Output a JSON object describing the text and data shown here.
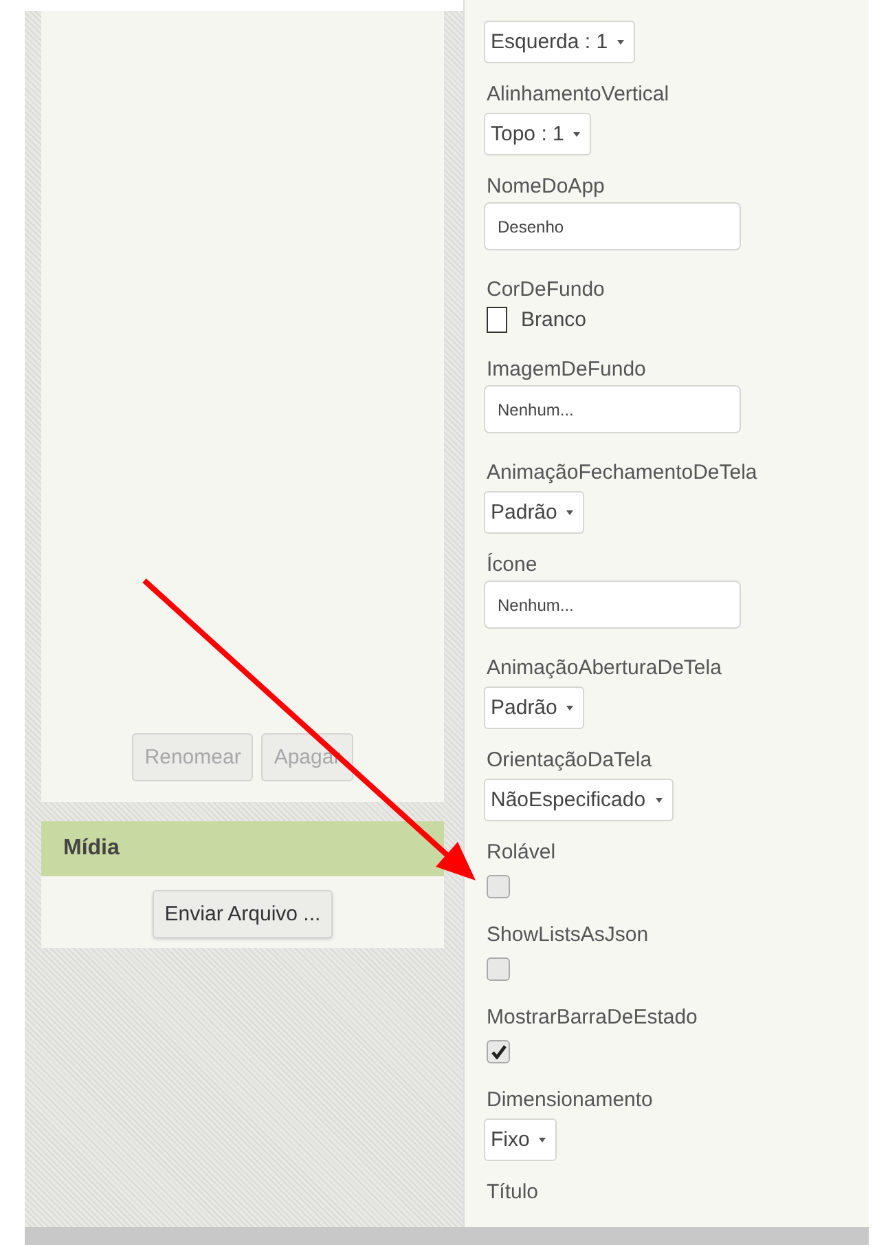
{
  "assets_panel": {
    "buttons": [
      {
        "label": "Renomear",
        "disabled": true
      },
      {
        "label": "Apagar",
        "disabled": true
      }
    ]
  },
  "media_panel": {
    "title": "Mídia",
    "button": "Enviar Arquivo ..."
  },
  "properties": [
    {
      "kind": "dropdown",
      "value": "Esquerda : 1"
    },
    {
      "kind": "dropdown",
      "label": "AlinhamentoVertical",
      "value": "Topo : 1"
    },
    {
      "kind": "textbox",
      "label": "NomeDoApp",
      "value": "Desenho"
    },
    {
      "kind": "color",
      "label": "CorDeFundo",
      "value": "Branco",
      "color": "#ffffff"
    },
    {
      "kind": "textbox",
      "label": "ImagemDeFundo",
      "value": "Nenhum..."
    },
    {
      "kind": "dropdown",
      "label": "AnimaçãoFechamentoDeTela",
      "value": "Padrão"
    },
    {
      "kind": "textbox",
      "label": "Ícone",
      "value": "Nenhum..."
    },
    {
      "kind": "dropdown",
      "label": "AnimaçãoAberturaDeTela",
      "value": "Padrão"
    },
    {
      "kind": "dropdown",
      "label": "OrientaçãoDaTela",
      "value": "NãoEspecificado"
    },
    {
      "kind": "checkbox",
      "label": "Rolável",
      "checked": false
    },
    {
      "kind": "checkbox",
      "label": "ShowListsAsJson",
      "checked": false
    },
    {
      "kind": "checkbox",
      "label": "MostrarBarraDeEstado",
      "checked": true
    },
    {
      "kind": "dropdown",
      "label": "Dimensionamento",
      "value": "Fixo"
    },
    {
      "kind": "label",
      "label": "Título"
    }
  ]
}
